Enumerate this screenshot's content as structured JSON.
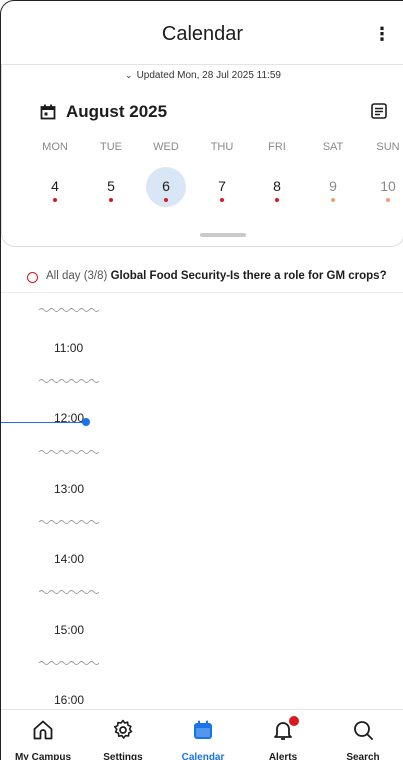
{
  "appbar": {
    "title": "Calendar",
    "more_icon": "more-vertical-icon"
  },
  "updated": {
    "chevron": "⌄",
    "text": "Updated Mon, 28 Jul 2025 11:59"
  },
  "month": {
    "label": "August 2025",
    "calendar_icon": "calendar-icon",
    "view_icon": "list-view-icon"
  },
  "weekdays": [
    "MON",
    "TUE",
    "WED",
    "THU",
    "FRI",
    "SAT",
    "SUN"
  ],
  "days": [
    {
      "num": "4",
      "has_event": true,
      "weekend": false,
      "selected": false
    },
    {
      "num": "5",
      "has_event": true,
      "weekend": false,
      "selected": false
    },
    {
      "num": "6",
      "has_event": true,
      "weekend": false,
      "selected": true
    },
    {
      "num": "7",
      "has_event": true,
      "weekend": false,
      "selected": false
    },
    {
      "num": "8",
      "has_event": true,
      "weekend": false,
      "selected": false
    },
    {
      "num": "9",
      "has_event": true,
      "weekend": true,
      "selected": false
    },
    {
      "num": "10",
      "has_event": true,
      "weekend": true,
      "selected": false
    }
  ],
  "allday": {
    "prefix": "All day (3/8)",
    "title": "Global Food Security-Is there a role for GM crops?"
  },
  "timeline": {
    "hours": [
      "11:00",
      "12:00",
      "13:00",
      "14:00",
      "15:00",
      "16:00"
    ]
  },
  "nav": [
    {
      "label": "My Campus",
      "icon": "home-icon",
      "active": false
    },
    {
      "label": "Settings",
      "icon": "gear-icon",
      "active": false
    },
    {
      "label": "Calendar",
      "icon": "calendar-icon",
      "active": true
    },
    {
      "label": "Alerts",
      "icon": "bell-icon",
      "active": false,
      "badge": true
    },
    {
      "label": "Search",
      "icon": "search-icon",
      "active": false
    }
  ],
  "colors": {
    "accent": "#1a73e8",
    "event": "#d71920",
    "weekend_event": "#f0a070",
    "selected_day": "#d9e6f5"
  }
}
